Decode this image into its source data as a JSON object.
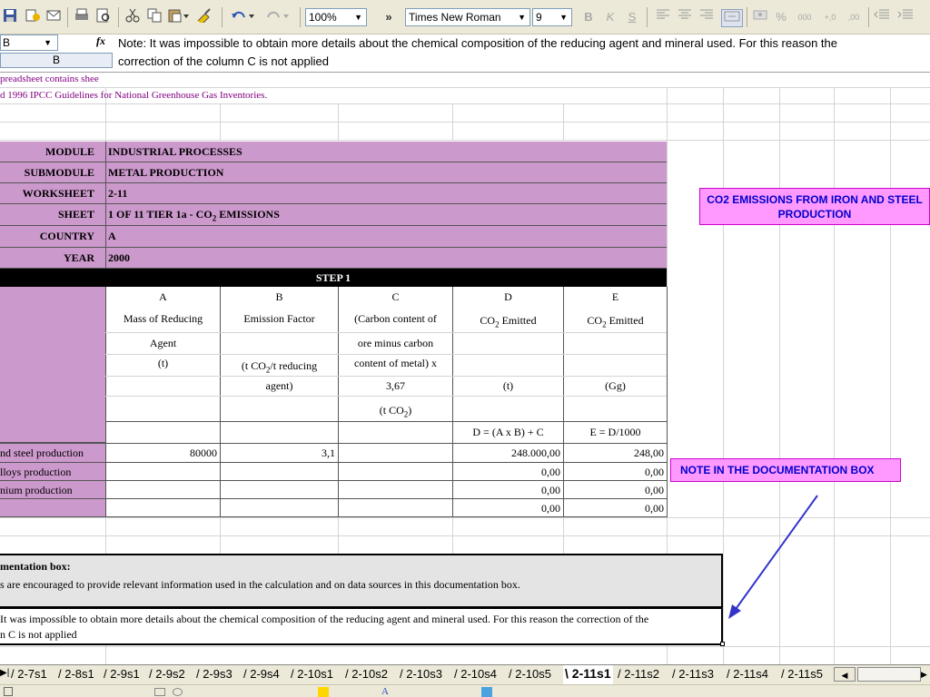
{
  "toolbar": {
    "zoom": "100%",
    "font_name": "Times New Roman",
    "font_size": "9",
    "bold_glyph": "B",
    "italic_glyph": "K",
    "underline_glyph": "S",
    "percent_glyph": "%",
    "thousands_glyph": "000",
    "increase_decimal_glyph": "+,0",
    "decrease_decimal_glyph": ",00",
    "more_glyph": "»",
    "icons": [
      "save-icon",
      "permission-icon",
      "email-icon",
      "print-icon",
      "print-preview-icon",
      "cut-icon",
      "copy-icon",
      "paste-icon",
      "format-painter-icon",
      "undo-icon",
      "redo-icon"
    ]
  },
  "formula_bar": {
    "name_box": "B",
    "fx": "fx",
    "formula_line1": "Note: It was impossible to obtain more details about the chemical composition of the reducing agent and mineral used. For this reason the",
    "formula_line2": "correction of the column C is not applied",
    "column_header_b": "B"
  },
  "sheet": {
    "intro1": "preadsheet contains shee",
    "intro2": "d 1996 IPCC Guidelines for National Greenhouse Gas Inventories.",
    "info": {
      "module_label": "MODULE",
      "module_value": "INDUSTRIAL PROCESSES",
      "submodule_label": "SUBMODULE",
      "submodule_value": "METAL PRODUCTION",
      "worksheet_label": "WORKSHEET",
      "worksheet_value": "2-11",
      "sheet_label": "SHEET",
      "sheet_value_pre": "1  OF  11  TIER 1a - CO",
      "sheet_value_sub": "2",
      "sheet_value_post": " EMISSIONS",
      "country_label": "COUNTRY",
      "country_value": "A",
      "year_label": "YEAR",
      "year_value": "2000"
    },
    "step": "STEP 1",
    "columns": {
      "a_letter": "A",
      "a_l1": "Mass of Reducing",
      "a_l2": "Agent",
      "a_l3": "(t)",
      "b_letter": "B",
      "b_l1": "Emission Factor",
      "b_l2_pre": "(t CO",
      "b_l2_sub": "2",
      "b_l2_post": "/t reducing",
      "b_l3": "agent)",
      "c_letter": "C",
      "c_l1": "(Carbon content of",
      "c_l2": "ore minus carbon",
      "c_l3": "content of metal) x",
      "c_l4": "3,67",
      "c_l5_pre": "(t CO",
      "c_l5_sub": "2",
      "c_l5_post": ")",
      "d_letter": "D",
      "d_l1_pre": "CO",
      "d_l1_sub": "2",
      "d_l1_post": " Emitted",
      "d_unit": "(t)",
      "d_formula": "D = (A x B) + C",
      "e_letter": "E",
      "e_l1_pre": "CO",
      "e_l1_sub": "2",
      "e_l1_post": " Emitted",
      "e_unit": "(Gg)",
      "e_formula": "E = D/1000"
    },
    "rows": [
      {
        "label": "nd steel production",
        "a": "80000",
        "b": "3,1",
        "c": "",
        "d": "248.000,00",
        "e": "248,00"
      },
      {
        "label": "lloys production",
        "a": "",
        "b": "",
        "c": "",
        "d": "0,00",
        "e": "0,00"
      },
      {
        "label": "nium production",
        "a": "",
        "b": "",
        "c": "",
        "d": "0,00",
        "e": "0,00"
      },
      {
        "label": "",
        "a": "",
        "b": "",
        "c": "",
        "d": "0,00",
        "e": "0,00"
      }
    ],
    "documentation": {
      "title": "mentation box:",
      "instruction": "s are encouraged to provide relevant information used in the calculation and on data sources in this documentation box.",
      "note_line1": "It was impossible to obtain more details about the chemical composition of the reducing agent and mineral used. For this reason the correction of the",
      "note_line2": "n C is not applied"
    },
    "callout_title": "CO2 EMISSIONS FROM IRON AND STEEL PRODUCTION",
    "callout_note": "NOTE IN THE DOCUMENTATION BOX"
  },
  "tabs": {
    "items": [
      "2-7s1",
      "2-8s1",
      "2-9s1",
      "2-9s2",
      "2-9s3",
      "2-9s4",
      "2-10s1",
      "2-10s2",
      "2-10s3",
      "2-10s4",
      "2-10s5",
      "2-11s1",
      "2-11s2",
      "2-11s3",
      "2-11s4",
      "2-11s5"
    ],
    "active": "2-11s1"
  },
  "colors": {
    "header_fill": "#cc99cc",
    "callout_fill": "#ff99ff",
    "callout_text": "#0000cc",
    "step_fill": "#000000",
    "arrow": "#3333cc"
  }
}
